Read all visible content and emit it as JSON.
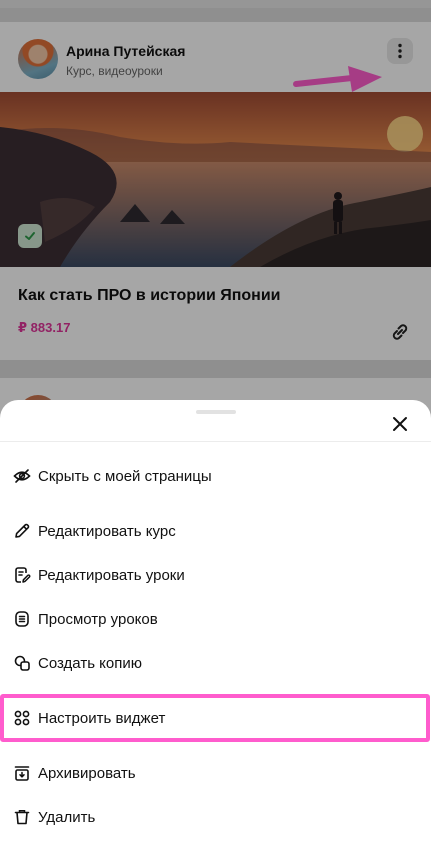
{
  "feed": {
    "card": {
      "author_name": "Арина Путейская",
      "author_subtitle": "Курс, видеоуроки",
      "course_title": "Как стать ПРО в истории Японии",
      "course_price": "₽ 883.17"
    }
  },
  "sheet": {
    "items": [
      {
        "label": "Скрыть с моей страницы",
        "icon": "eye-off-icon"
      },
      {
        "label": "Редактировать курс",
        "icon": "pencil-icon"
      },
      {
        "label": "Редактировать уроки",
        "icon": "edit-lessons-icon"
      },
      {
        "label": "Просмотр уроков",
        "icon": "list-view-icon"
      },
      {
        "label": "Создать копию",
        "icon": "copy-icon"
      },
      {
        "label": "Настроить виджет",
        "icon": "widget-icon"
      },
      {
        "label": "Архивировать",
        "icon": "archive-icon"
      },
      {
        "label": "Удалить",
        "icon": "trash-icon"
      }
    ],
    "highlighted_item": "Настроить виджет"
  },
  "colors": {
    "price": "#e0359a",
    "annotation": "#ff5ccd",
    "badge": "#cfe9d4"
  }
}
